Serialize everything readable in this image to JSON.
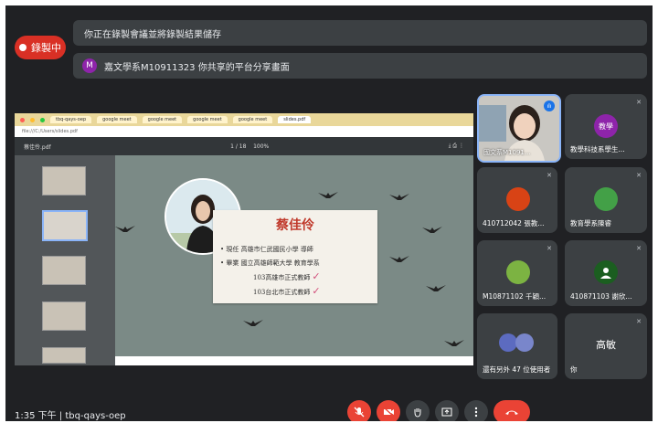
{
  "meeting": {
    "recording_label": "錄製中",
    "notice_1": "你正在錄製會議並將錄製結果儲存",
    "notice_2": "嘉文學系M10911323 你共享的平台分享畫面",
    "notice_2_badge": "M",
    "time": "1:35 下午",
    "separator": "|",
    "code": "tbq-qays-oep"
  },
  "browser": {
    "tabs": [
      "tbq-qays-oep",
      "google meet",
      "google meet",
      "google meet",
      "google meet",
      "slides.pdf"
    ],
    "address": "file:///C:/Users/slides.pdf",
    "pdf_title": "蔡佳伶.pdf",
    "pdf_page": "1 / 18",
    "pdf_zoom": "100%"
  },
  "slide": {
    "name": "蔡佳伶",
    "lines": [
      "現任 高雄市仁武國民小學 導師",
      "畢業 國立高雄師範大學 教育學系",
      "103高雄市正式教師",
      "103台北市正式教師"
    ],
    "check_glyph": "✓"
  },
  "participants": [
    {
      "label": "國文系M1091...",
      "avatar": "",
      "color": "#c7c3bd"
    },
    {
      "label": "教學科技系學生...",
      "avatar": "教學",
      "color": "#8e24aa"
    },
    {
      "label": "410712042 張教...",
      "avatar": "",
      "color": "#d84315"
    },
    {
      "label": "教育學系陳睿",
      "avatar": "",
      "color": "#43a047"
    },
    {
      "label": "M10871102 千穎...",
      "avatar": "",
      "color": "#7cb342"
    },
    {
      "label": "410871103 謝欣...",
      "avatar": "",
      "color": "#1b5e20"
    },
    {
      "label": "還有另外 47 位使用者",
      "avatar": "",
      "color": "#5c6bc0"
    },
    {
      "label": "你",
      "avatar": "高敏",
      "color": "#3c4043"
    }
  ],
  "icons": {
    "mic_off": "mic-off-icon",
    "cam_off": "camera-off-icon",
    "hand": "raise-hand-icon",
    "present": "present-icon",
    "more": "more-options-icon",
    "end": "end-call-icon"
  },
  "colors": {
    "accent_red": "#ea4335",
    "bg": "#202124",
    "tile": "#3c4043"
  }
}
